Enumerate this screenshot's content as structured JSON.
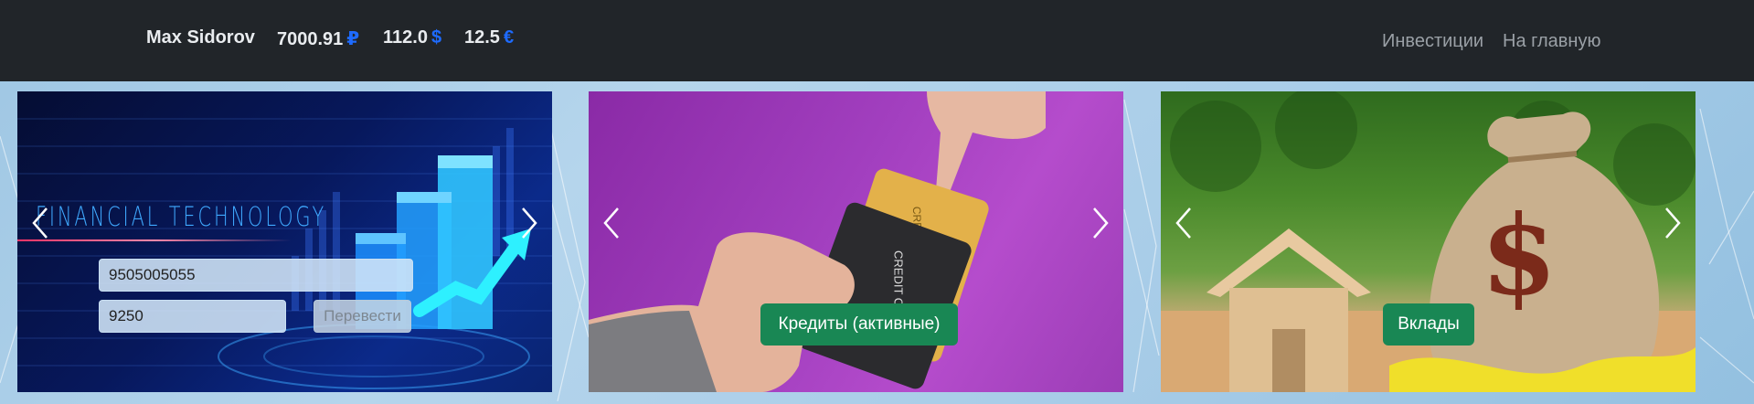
{
  "navbar": {
    "user_name": "Max Sidorov",
    "balances": [
      {
        "amount": "7000.91",
        "currency": "₽"
      },
      {
        "amount": "112.0",
        "currency": "$"
      },
      {
        "amount": "12.5",
        "currency": "€"
      }
    ],
    "links": [
      "Инвестиции",
      "На главную"
    ]
  },
  "cards": {
    "transfer": {
      "image_title": "FINANCIAL TECHNOLOGY",
      "phone_value": "9505005055",
      "amount_value": "9250",
      "button_label": "Перевести"
    },
    "credits": {
      "card_text_1": "CREDIT CARD",
      "card_text_2": "CREDIT CARD",
      "button_label": "Кредиты (активные)"
    },
    "deposits": {
      "bag_symbol": "$",
      "button_label": "Вклады"
    }
  },
  "colors": {
    "navbar_bg": "#212529",
    "currency_accent": "#1e6bff",
    "success_button": "#198754"
  },
  "icons": [
    "chevron-left-icon",
    "chevron-right-icon"
  ]
}
